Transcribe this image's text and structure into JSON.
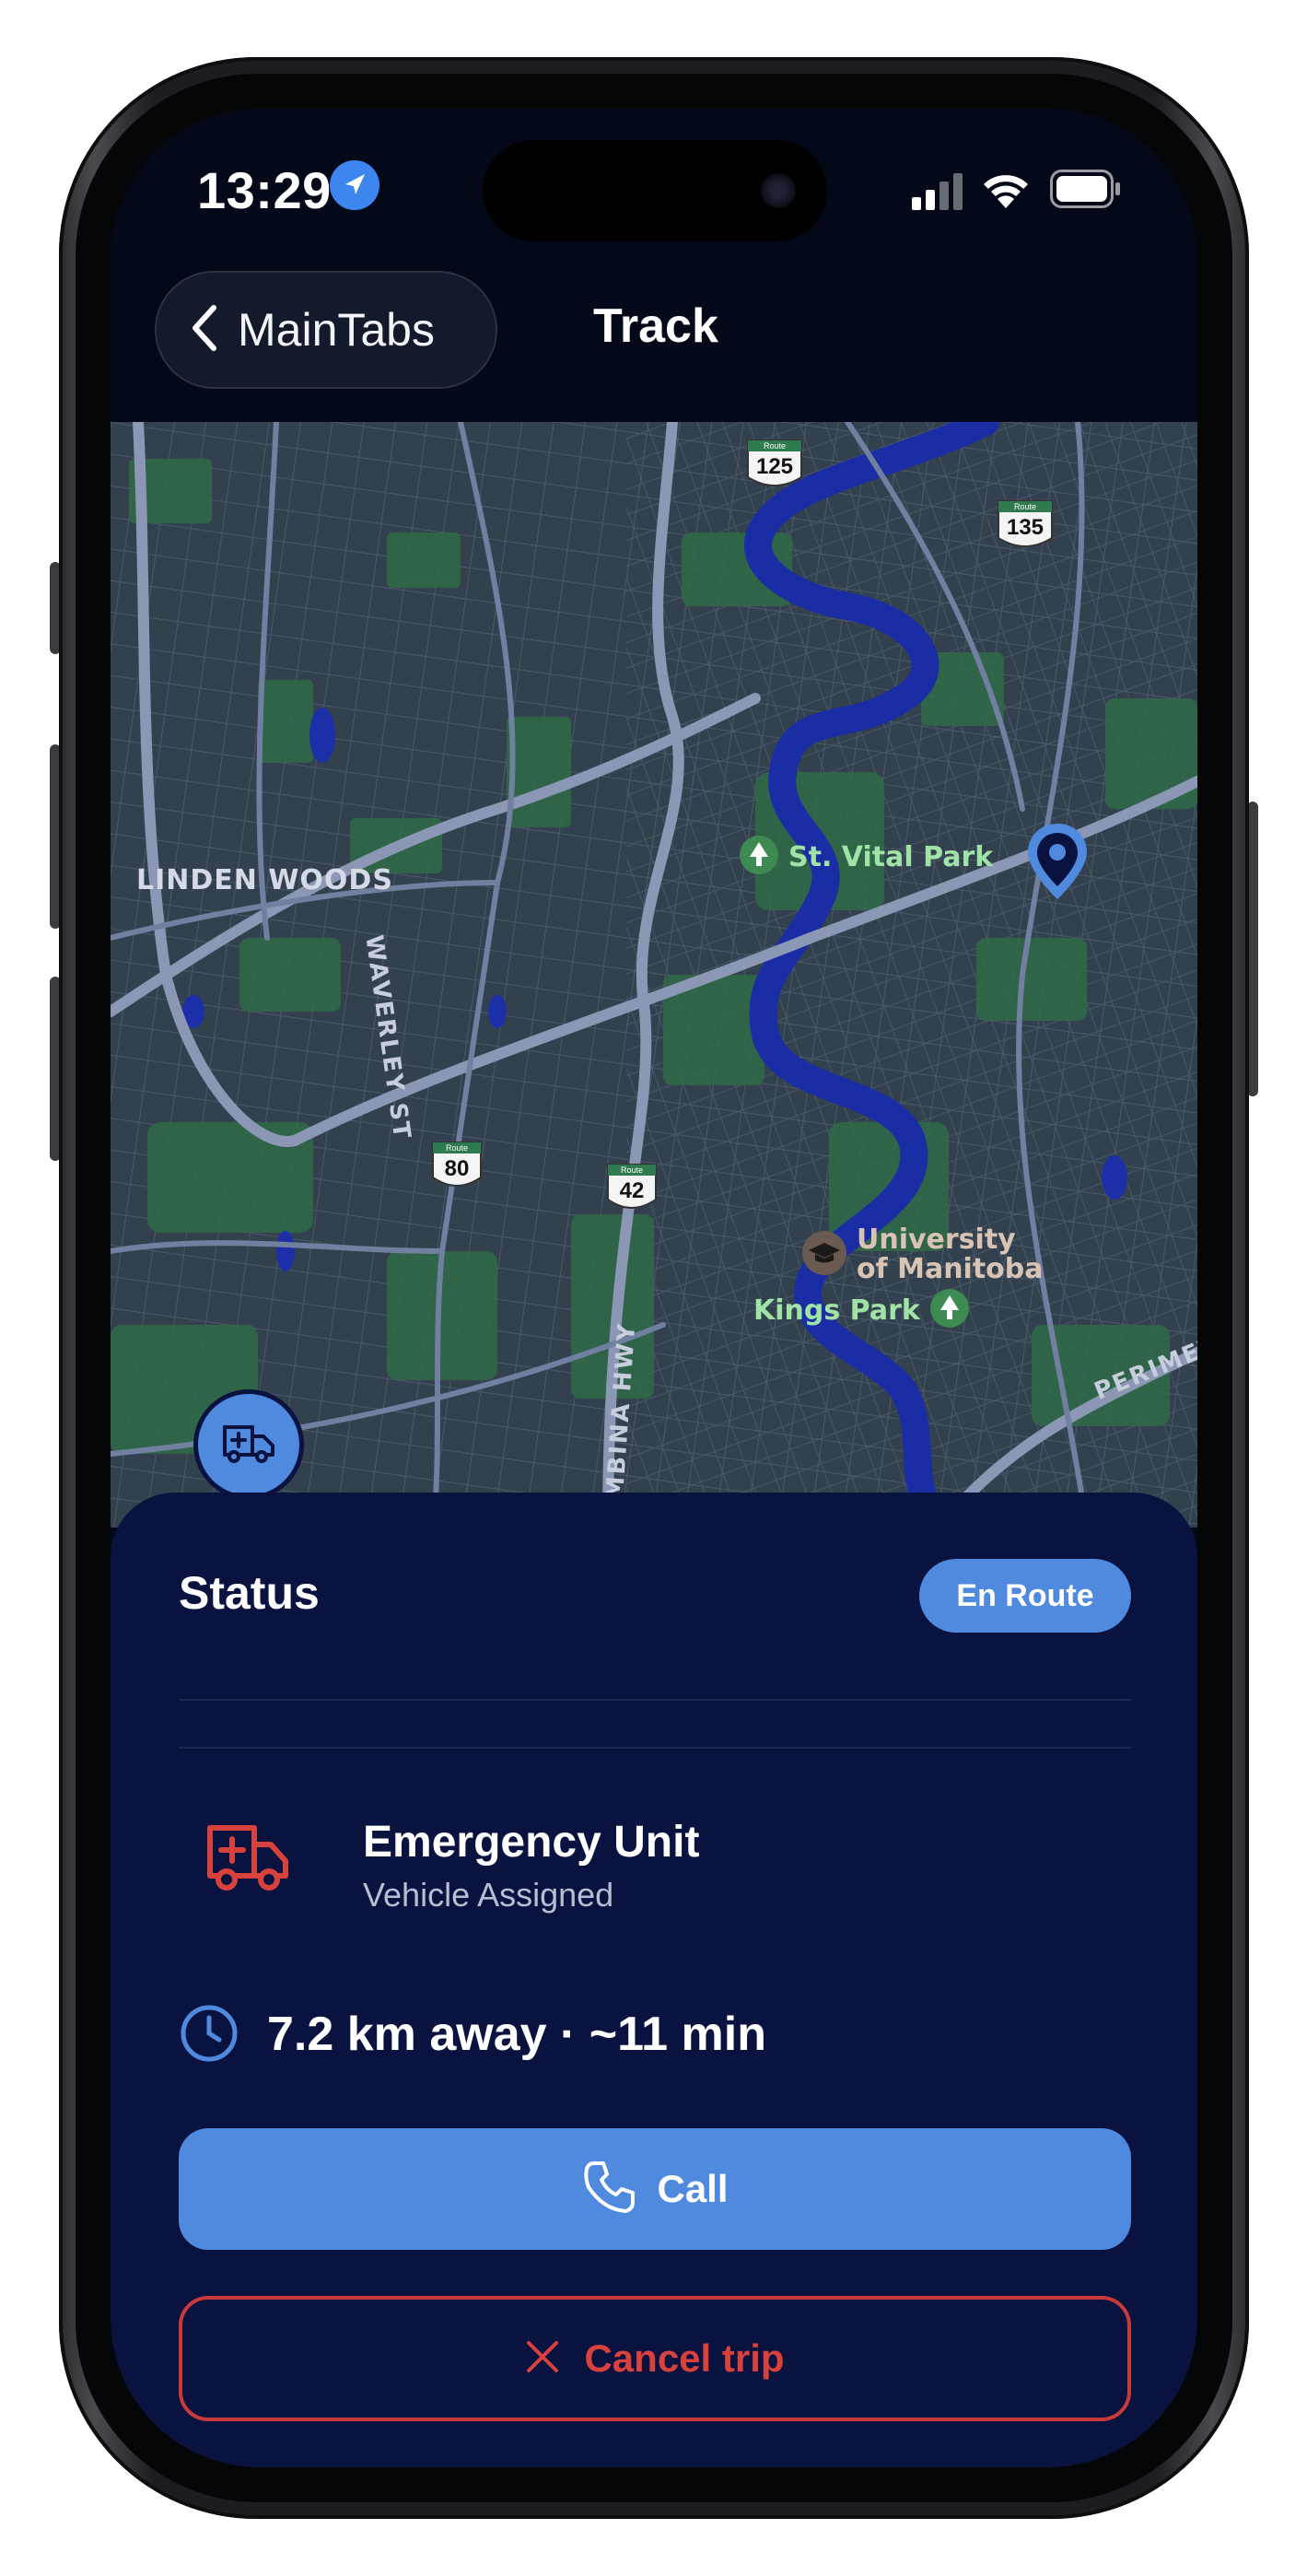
{
  "status_bar": {
    "time": "13:29",
    "location_icon": "location-arrow-icon",
    "signal_icon": "cellular-signal-icon",
    "wifi_icon": "wifi-icon",
    "battery_icon": "battery-icon"
  },
  "nav": {
    "back_label": "MainTabs",
    "title": "Track"
  },
  "map": {
    "area_labels": [
      "LINDEN WOODS",
      "WAVERLEY ST",
      "PEMBINA HWY",
      "PERIMETE"
    ],
    "pois": [
      "St. Vital Park",
      "University",
      "of Manitoba",
      "Kings Park"
    ],
    "route_shields": [
      {
        "label": "Route",
        "number": "125"
      },
      {
        "label": "Route",
        "number": "135"
      },
      {
        "label": "Route",
        "number": "80"
      },
      {
        "label": "Route",
        "number": "42"
      }
    ],
    "vehicle_marker_icon": "ambulance-icon",
    "destination_marker_icon": "map-pin-icon"
  },
  "sheet": {
    "status_label": "Status",
    "status_badge": "En Route",
    "unit_title": "Emergency Unit",
    "unit_subtitle": "Vehicle Assigned",
    "eta_text": "7.2 km away · ~11 min",
    "call_label": "Call",
    "cancel_label": "Cancel trip"
  },
  "colors": {
    "accent": "#4f8ade",
    "danger": "#d9423c",
    "sheet_bg": "#0a1240",
    "screen_bg": "#030918"
  }
}
